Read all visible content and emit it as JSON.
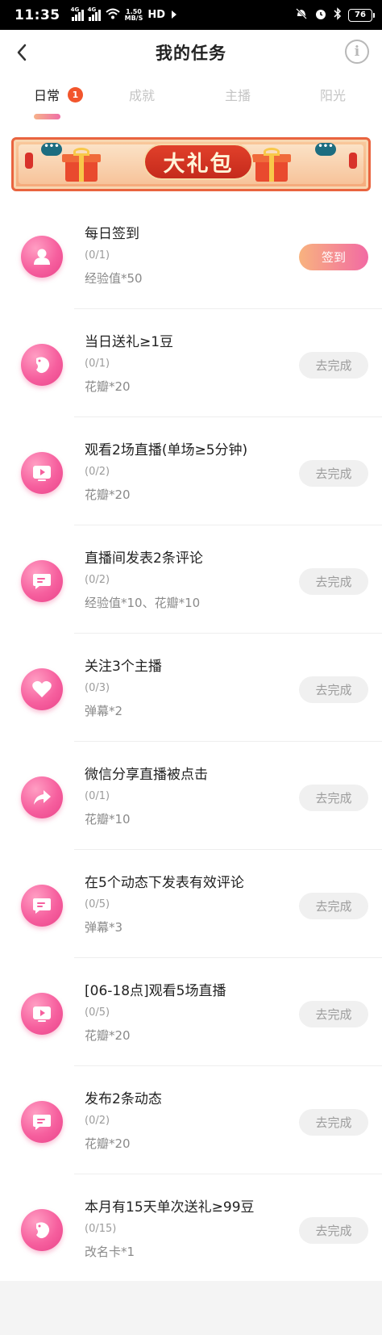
{
  "status_bar": {
    "time": "11:35",
    "signal1_tag": "4G",
    "signal2_tag": "4G",
    "net_speed_top": "1.50",
    "net_speed_bottom": "MB/S",
    "hd": "HD",
    "battery": "76"
  },
  "header": {
    "title": "我的任务",
    "back_icon": "chevron-left-icon",
    "info_icon": "info-icon",
    "info_glyph": "i"
  },
  "tabs": [
    {
      "label": "日常",
      "badge": "1",
      "active": true
    },
    {
      "label": "成就"
    },
    {
      "label": "主播"
    },
    {
      "label": "阳光"
    }
  ],
  "banner": {
    "title": "大礼包",
    "bubble_text": "•••"
  },
  "tasks": [
    {
      "title": "每日签到",
      "progress": "(0/1)",
      "reward": "经验值*50",
      "button": "签到",
      "button_style": "primary",
      "icon": "user-icon"
    },
    {
      "title": "当日送礼≥1豆",
      "progress": "(0/1)",
      "reward": "花瓣*20",
      "button": "去完成",
      "button_style": "default",
      "icon": "bean-icon"
    },
    {
      "title": "观看2场直播(单场≥5分钟)",
      "progress": "(0/2)",
      "reward": "花瓣*20",
      "button": "去完成",
      "button_style": "default",
      "icon": "video-play-icon"
    },
    {
      "title": "直播间发表2条评论",
      "progress": "(0/2)",
      "reward": "经验值*10、花瓣*10",
      "button": "去完成",
      "button_style": "default",
      "icon": "comment-icon"
    },
    {
      "title": "关注3个主播",
      "progress": "(0/3)",
      "reward": "弹幕*2",
      "button": "去完成",
      "button_style": "default",
      "icon": "heart-icon"
    },
    {
      "title": "微信分享直播被点击",
      "progress": "(0/1)",
      "reward": "花瓣*10",
      "button": "去完成",
      "button_style": "default",
      "icon": "share-icon"
    },
    {
      "title": "在5个动态下发表有效评论",
      "progress": "(0/5)",
      "reward": "弹幕*3",
      "button": "去完成",
      "button_style": "default",
      "icon": "comment-icon"
    },
    {
      "title": "[06-18点]观看5场直播",
      "progress": "(0/5)",
      "reward": "花瓣*20",
      "button": "去完成",
      "button_style": "default",
      "icon": "video-play-icon"
    },
    {
      "title": "发布2条动态",
      "progress": "(0/2)",
      "reward": "花瓣*20",
      "button": "去完成",
      "button_style": "default",
      "icon": "comment-icon"
    },
    {
      "title": "本月有15天单次送礼≥99豆",
      "progress": "(0/15)",
      "reward": "改名卡*1",
      "button": "去完成",
      "button_style": "default",
      "icon": "bean-icon"
    }
  ],
  "colors": {
    "accent_pink": "#f26aa3",
    "accent_orange": "#f8b37f",
    "badge_red": "#f2552c",
    "icon_pink": "#f65f9e"
  }
}
